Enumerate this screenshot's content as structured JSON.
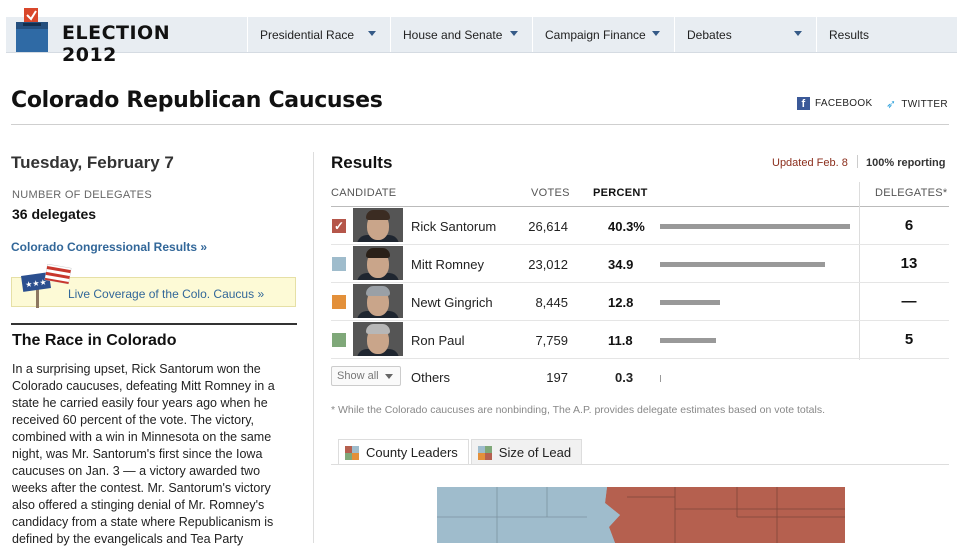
{
  "nav": {
    "brand": "ELECTION 2012",
    "items": [
      {
        "label": "Presidential Race",
        "dropdown": true
      },
      {
        "label": "House and Senate",
        "dropdown": true
      },
      {
        "label": "Campaign Finance",
        "dropdown": true
      },
      {
        "label": "Debates",
        "dropdown": true
      },
      {
        "label": "Results",
        "dropdown": false
      }
    ]
  },
  "page": {
    "title": "Colorado Republican Caucuses",
    "share_facebook": "FACEBOOK",
    "share_twitter": "TWITTER"
  },
  "sidebar": {
    "date": "Tuesday, February 7",
    "delegates_label": "NUMBER OF DELEGATES",
    "delegates_value": "36 delegates",
    "congressional_link": "Colorado Congressional Results »",
    "live_coverage_link": "Live Coverage of the Colo. Caucus »",
    "race_heading": "The Race in Colorado",
    "race_text": "In a surprising upset, Rick Santorum won the Colorado caucuses, defeating Mitt Romney in a state he carried easily four years ago when he received 60 percent of the vote. The victory, combined with a win in Minnesota on the same night, was Mr. Santorum's first since the Iowa caucuses on Jan. 3 — a victory awarded two weeks after the contest. Mr. Santorum's victory also offered a stinging denial of Mr. Romney's candidacy from a state where Republicanism is defined by the evangelicals and Tea Party"
  },
  "results": {
    "heading": "Results",
    "updated": "Updated Feb. 8",
    "reporting": "100% reporting",
    "headers": {
      "candidate": "CANDIDATE",
      "votes": "VOTES",
      "percent": "PERCENT",
      "delegates": "DELEGATES*"
    },
    "rows": [
      {
        "name": "Rick Santorum",
        "votes": "26,614",
        "percent": "40.3%",
        "pct_value": 40.3,
        "delegates": "6",
        "color": "#b5564a",
        "winner": true,
        "hair": "#3b2c22"
      },
      {
        "name": "Mitt Romney",
        "votes": "23,012",
        "percent": "34.9",
        "pct_value": 34.9,
        "delegates": "13",
        "color": "#9fbccc",
        "winner": false,
        "hair": "#2a2018"
      },
      {
        "name": "Newt Gingrich",
        "votes": "8,445",
        "percent": "12.8",
        "pct_value": 12.8,
        "delegates": "—",
        "color": "#e3903a",
        "winner": false,
        "hair": "#9aa0a6"
      },
      {
        "name": "Ron Paul",
        "votes": "7,759",
        "percent": "11.8",
        "pct_value": 11.8,
        "delegates": "5",
        "color": "#7fa879",
        "winner": false,
        "hair": "#b7b7b7"
      }
    ],
    "others": {
      "show_all": "Show all",
      "name": "Others",
      "votes": "197",
      "percent": "0.3",
      "pct_value": 0.3
    },
    "footnote": "* While the Colorado caucuses are nonbinding, The A.P. provides delegate estimates based on vote totals."
  },
  "map": {
    "tabs": [
      "County Leaders",
      "Size of Lead"
    ],
    "active_tab": "County Leaders",
    "colors": {
      "santorum": "#b5604f",
      "romney": "#9fbccc"
    }
  }
}
